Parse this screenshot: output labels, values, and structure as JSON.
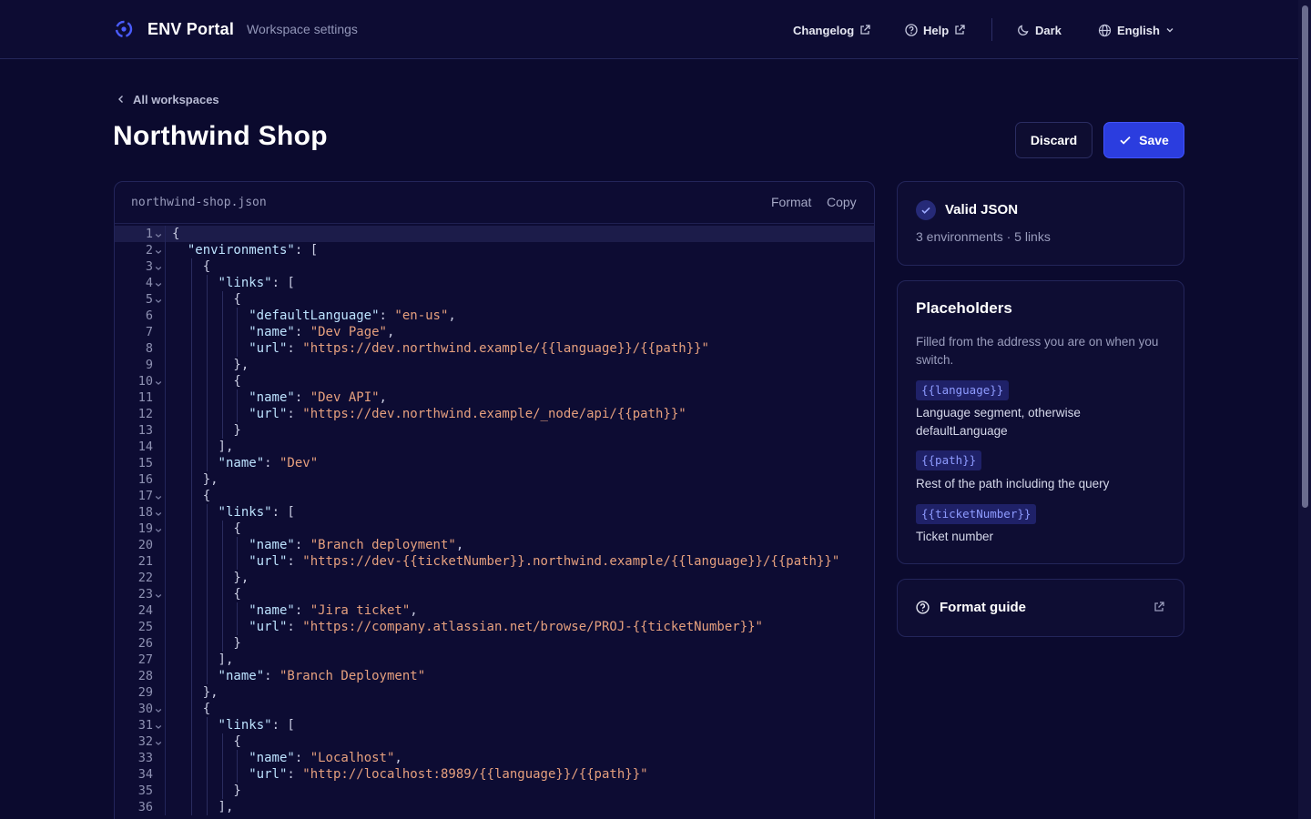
{
  "header": {
    "brand": "ENV Portal",
    "subtitle": "Workspace settings",
    "nav": {
      "changelog": "Changelog",
      "help": "Help",
      "theme": "Dark",
      "language": "English"
    }
  },
  "breadcrumb": {
    "back_label": "All workspaces"
  },
  "page": {
    "title": "Northwind Shop"
  },
  "actions": {
    "discard": "Discard",
    "save": "Save"
  },
  "editor": {
    "filename": "northwind-shop.json",
    "format_label": "Format",
    "copy_label": "Copy",
    "active_line": 1,
    "lines": [
      {
        "n": "1",
        "fold": true,
        "indent": 0,
        "text": "{"
      },
      {
        "n": "2",
        "fold": true,
        "indent": 1,
        "text": "\"environments\": ["
      },
      {
        "n": "3",
        "fold": true,
        "indent": 2,
        "text": "{"
      },
      {
        "n": "4",
        "fold": true,
        "indent": 3,
        "text": "\"links\": ["
      },
      {
        "n": "5",
        "fold": true,
        "indent": 4,
        "text": "{"
      },
      {
        "n": "6",
        "fold": false,
        "indent": 5,
        "text": "\"defaultLanguage\": \"en-us\","
      },
      {
        "n": "7",
        "fold": false,
        "indent": 5,
        "text": "\"name\": \"Dev Page\","
      },
      {
        "n": "8",
        "fold": false,
        "indent": 5,
        "text": "\"url\": \"https://dev.northwind.example/{{language}}/{{path}}\""
      },
      {
        "n": "9",
        "fold": false,
        "indent": 4,
        "text": "},"
      },
      {
        "n": "10",
        "fold": true,
        "indent": 4,
        "text": "{"
      },
      {
        "n": "11",
        "fold": false,
        "indent": 5,
        "text": "\"name\": \"Dev API\","
      },
      {
        "n": "12",
        "fold": false,
        "indent": 5,
        "text": "\"url\": \"https://dev.northwind.example/_node/api/{{path}}\""
      },
      {
        "n": "13",
        "fold": false,
        "indent": 4,
        "text": "}"
      },
      {
        "n": "14",
        "fold": false,
        "indent": 3,
        "text": "],"
      },
      {
        "n": "15",
        "fold": false,
        "indent": 3,
        "text": "\"name\": \"Dev\""
      },
      {
        "n": "16",
        "fold": false,
        "indent": 2,
        "text": "},"
      },
      {
        "n": "17",
        "fold": true,
        "indent": 2,
        "text": "{"
      },
      {
        "n": "18",
        "fold": true,
        "indent": 3,
        "text": "\"links\": ["
      },
      {
        "n": "19",
        "fold": true,
        "indent": 4,
        "text": "{"
      },
      {
        "n": "20",
        "fold": false,
        "indent": 5,
        "text": "\"name\": \"Branch deployment\","
      },
      {
        "n": "21",
        "fold": false,
        "indent": 5,
        "text": "\"url\": \"https://dev-{{ticketNumber}}.northwind.example/{{language}}/{{path}}\""
      },
      {
        "n": "22",
        "fold": false,
        "indent": 4,
        "text": "},"
      },
      {
        "n": "23",
        "fold": true,
        "indent": 4,
        "text": "{"
      },
      {
        "n": "24",
        "fold": false,
        "indent": 5,
        "text": "\"name\": \"Jira ticket\","
      },
      {
        "n": "25",
        "fold": false,
        "indent": 5,
        "text": "\"url\": \"https://company.atlassian.net/browse/PROJ-{{ticketNumber}}\""
      },
      {
        "n": "26",
        "fold": false,
        "indent": 4,
        "text": "}"
      },
      {
        "n": "27",
        "fold": false,
        "indent": 3,
        "text": "],"
      },
      {
        "n": "28",
        "fold": false,
        "indent": 3,
        "text": "\"name\": \"Branch Deployment\""
      },
      {
        "n": "29",
        "fold": false,
        "indent": 2,
        "text": "},"
      },
      {
        "n": "30",
        "fold": true,
        "indent": 2,
        "text": "{"
      },
      {
        "n": "31",
        "fold": true,
        "indent": 3,
        "text": "\"links\": ["
      },
      {
        "n": "32",
        "fold": true,
        "indent": 4,
        "text": "{"
      },
      {
        "n": "33",
        "fold": false,
        "indent": 5,
        "text": "\"name\": \"Localhost\","
      },
      {
        "n": "34",
        "fold": false,
        "indent": 5,
        "text": "\"url\": \"http://localhost:8989/{{language}}/{{path}}\""
      },
      {
        "n": "35",
        "fold": false,
        "indent": 4,
        "text": "}"
      },
      {
        "n": "36",
        "fold": false,
        "indent": 3,
        "text": "],"
      }
    ]
  },
  "validation": {
    "title": "Valid JSON",
    "summary": "3 environments · 5 links"
  },
  "placeholders": {
    "title": "Placeholders",
    "description": "Filled from the address you are on when you switch.",
    "items": [
      {
        "token": "{{language}}",
        "desc": "Language segment, otherwise defaultLanguage"
      },
      {
        "token": "{{path}}",
        "desc": "Rest of the path including the query"
      },
      {
        "token": "{{ticketNumber}}",
        "desc": "Ticket number"
      }
    ]
  },
  "format_guide": {
    "label": "Format guide"
  },
  "colors": {
    "background": "#0b0a2e",
    "accent": "#2b3ddf",
    "json_key": "#bde3ff",
    "json_string": "#e6a07e",
    "chip_text": "#8e9bff"
  }
}
